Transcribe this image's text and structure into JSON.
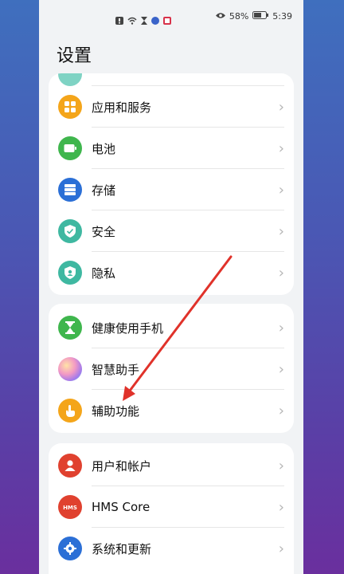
{
  "status_bar": {
    "battery_percent": "58%",
    "time": "5:39"
  },
  "page_title": "设置",
  "groups": [
    {
      "items": [
        {
          "label": "应用和服务",
          "icon": "apps-icon",
          "color": "#f4a51a"
        },
        {
          "label": "电池",
          "icon": "battery-icon",
          "color": "#3fb64d"
        },
        {
          "label": "存储",
          "icon": "storage-icon",
          "color": "#2b6fd6"
        },
        {
          "label": "安全",
          "icon": "shield-check-icon",
          "color": "#3fb8a1"
        },
        {
          "label": "隐私",
          "icon": "privacy-shield-icon",
          "color": "#3fb8a1"
        }
      ]
    },
    {
      "items": [
        {
          "label": "健康使用手机",
          "icon": "hourglass-icon",
          "color": "#3fb64d"
        },
        {
          "label": "智慧助手",
          "icon": "assistant-orb-icon",
          "color": "#c879e0"
        },
        {
          "label": "辅助功能",
          "icon": "hand-icon",
          "color": "#f4a51a"
        }
      ]
    },
    {
      "items": [
        {
          "label": "用户和帐户",
          "icon": "user-icon",
          "color": "#e0412f"
        },
        {
          "label": "HMS Core",
          "icon": "hms-icon",
          "color": "#e0412f"
        },
        {
          "label": "系统和更新",
          "icon": "gear-icon",
          "color": "#2b6fd6"
        }
      ]
    }
  ],
  "chevron": "›",
  "annotation": {
    "arrow_color": "#e0322a"
  }
}
